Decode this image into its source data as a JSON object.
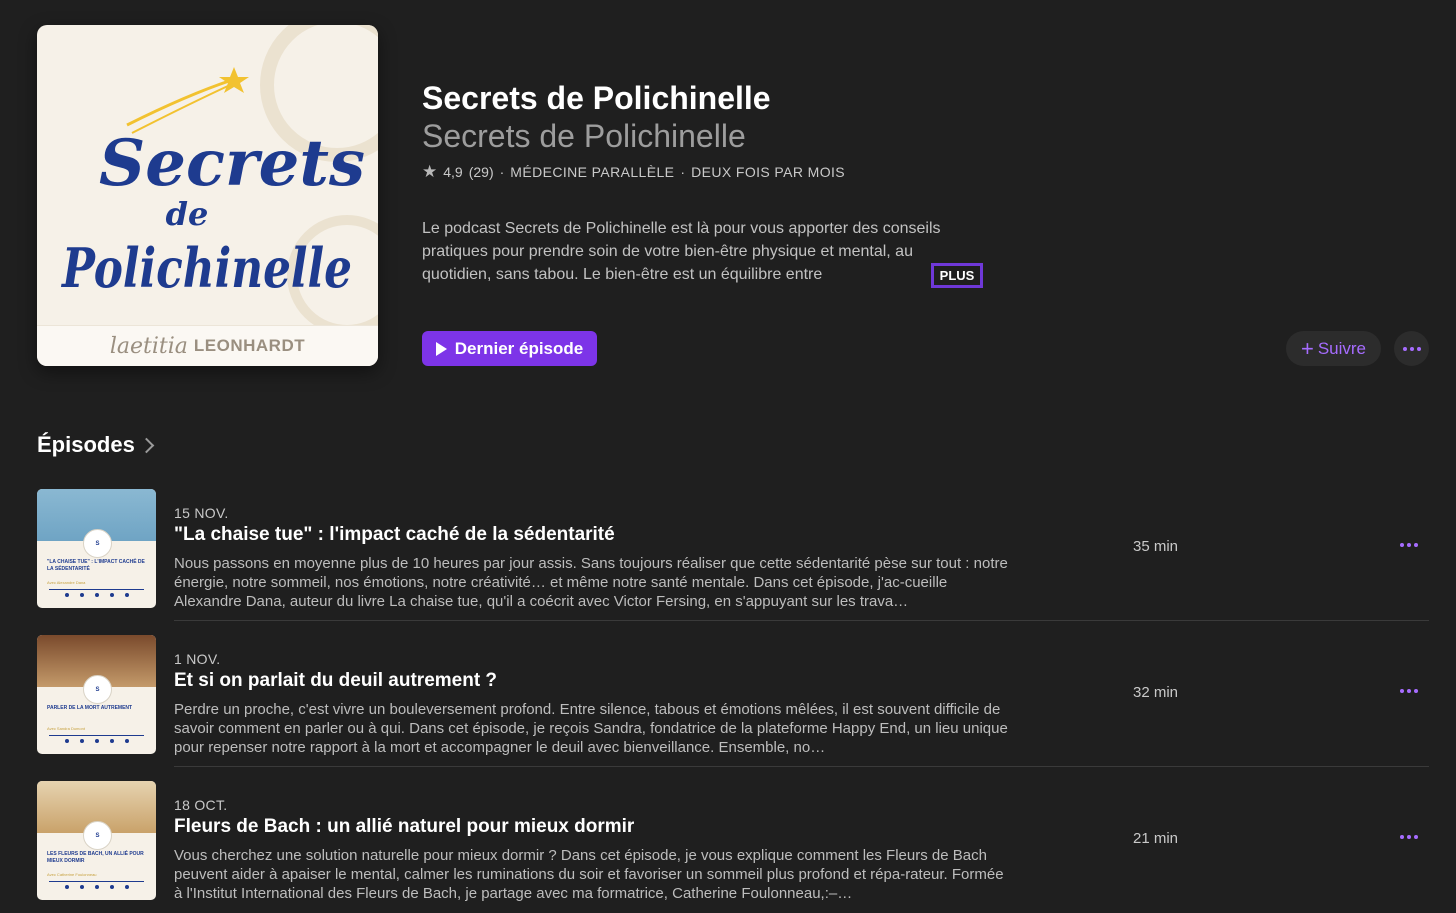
{
  "podcast": {
    "artwork": {
      "line1": "Secrets",
      "line2": "de",
      "line3": "Polichinelle",
      "author_first": "laetitia",
      "author_last": "LEONHARDT"
    },
    "title": "Secrets de Polichinelle",
    "author": "Secrets de Polichinelle",
    "rating": "4,9",
    "rating_count": "(29)",
    "separator": "·",
    "category": "MÉDECINE PARALLÈLE",
    "frequency": "DEUX FOIS PAR MOIS",
    "description": "Le podcast Secrets de Polichinelle est là pour vous apporter des conseils pratiques pour prendre soin de votre bien-être physique et mental, au quotidien, sans tabou. Le bien-être est un équilibre entre",
    "more_label": "PLUS",
    "latest_label": "Dernier épisode",
    "follow_label": "Suivre"
  },
  "episodes_heading": "Épisodes",
  "episodes": [
    {
      "date": "15 NOV.",
      "title": "\"La chaise tue\" : l'impact caché de la sédentarité",
      "description": "Nous passons en moyenne plus de 10 heures par jour assis. Sans toujours réaliser que cette sédentarité pèse sur tout : notre énergie, notre sommeil, nos émotions, notre créativité… et même notre santé mentale. Dans cet épisode, j'ac-cueille Alexandre Dana, auteur du livre La chaise tue, qu'il a coécrit avec Victor Fersing, en s'appuyant sur les trava…",
      "duration": "35 min",
      "thumb_caption": "\"LA CHAISE TUE\" : L'IMPACT CACHÉ DE LA SÉDENTARITÉ",
      "thumb_author": "Avec Alexandre Dana",
      "thumb_photo": "#6fa4c4"
    },
    {
      "date": "1 NOV.",
      "title": "Et si on parlait du deuil autrement ?",
      "description": "Perdre un proche, c'est vivre un bouleversement profond. Entre silence, tabous et émotions mêlées, il est souvent difficile de savoir comment en parler ou à qui. Dans cet épisode, je reçois Sandra, fondatrice de la plateforme Happy End, un lieu unique pour repenser notre rapport à la mort et accompagner le deuil avec bienveillance. Ensemble, no…",
      "duration": "32 min",
      "thumb_caption": "PARLER DE LA MORT AUTREMENT",
      "thumb_author": "Avec Sandra Dumont",
      "thumb_photo": "#9a6b45"
    },
    {
      "date": "18 OCT.",
      "title": "Fleurs de Bach : un allié naturel pour mieux dormir",
      "description": "Vous cherchez une solution naturelle pour mieux dormir ? Dans cet épisode, je vous explique comment les Fleurs de Bach peuvent aider à apaiser le mental, calmer les ruminations du soir et favoriser un sommeil plus profond et répa-rateur. Formée à l'Institut International des Fleurs de Bach, je partage avec ma formatrice, Catherine Foulonneau,:–…",
      "duration": "21 min",
      "thumb_caption": "LES FLEURS DE BACH, UN ALLIÉ POUR MIEUX DORMIR",
      "thumb_author": "Avec Catherine Foulonneau",
      "thumb_photo": "#c9a26a"
    }
  ],
  "colors": {
    "accent": "#7d34e8",
    "accent_text": "#a66cff",
    "background": "#1f1f1f",
    "logo_blue": "#1e3b8f",
    "star_yellow": "#f2c230"
  },
  "icons": [
    "star-icon",
    "play-icon",
    "plus-icon",
    "more-icon",
    "chevron-right-icon"
  ]
}
